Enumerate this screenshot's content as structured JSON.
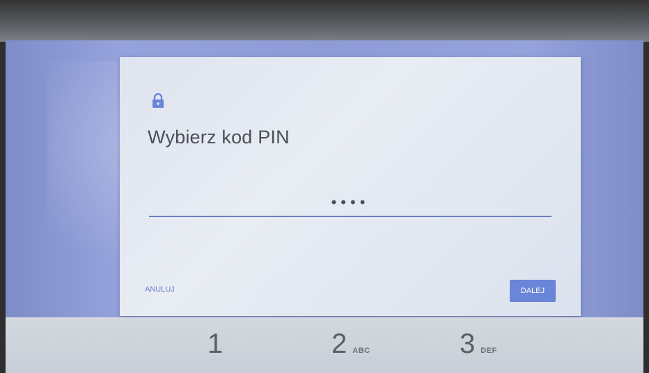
{
  "dialog": {
    "icon": "lock-icon",
    "title": "Wybierz kod PIN",
    "pin_value": "••••",
    "cancel_label": "ANULUJ",
    "next_label": "DALEJ"
  },
  "keypad": {
    "keys": [
      {
        "digit": "1",
        "letters": ""
      },
      {
        "digit": "2",
        "letters": "ABC"
      },
      {
        "digit": "3",
        "letters": "DEF"
      }
    ]
  },
  "colors": {
    "accent": "#6a86d8",
    "backdrop": "#8e9bd6",
    "dialog_bg": "#e4e8f0",
    "title_text": "#4a4f57"
  }
}
